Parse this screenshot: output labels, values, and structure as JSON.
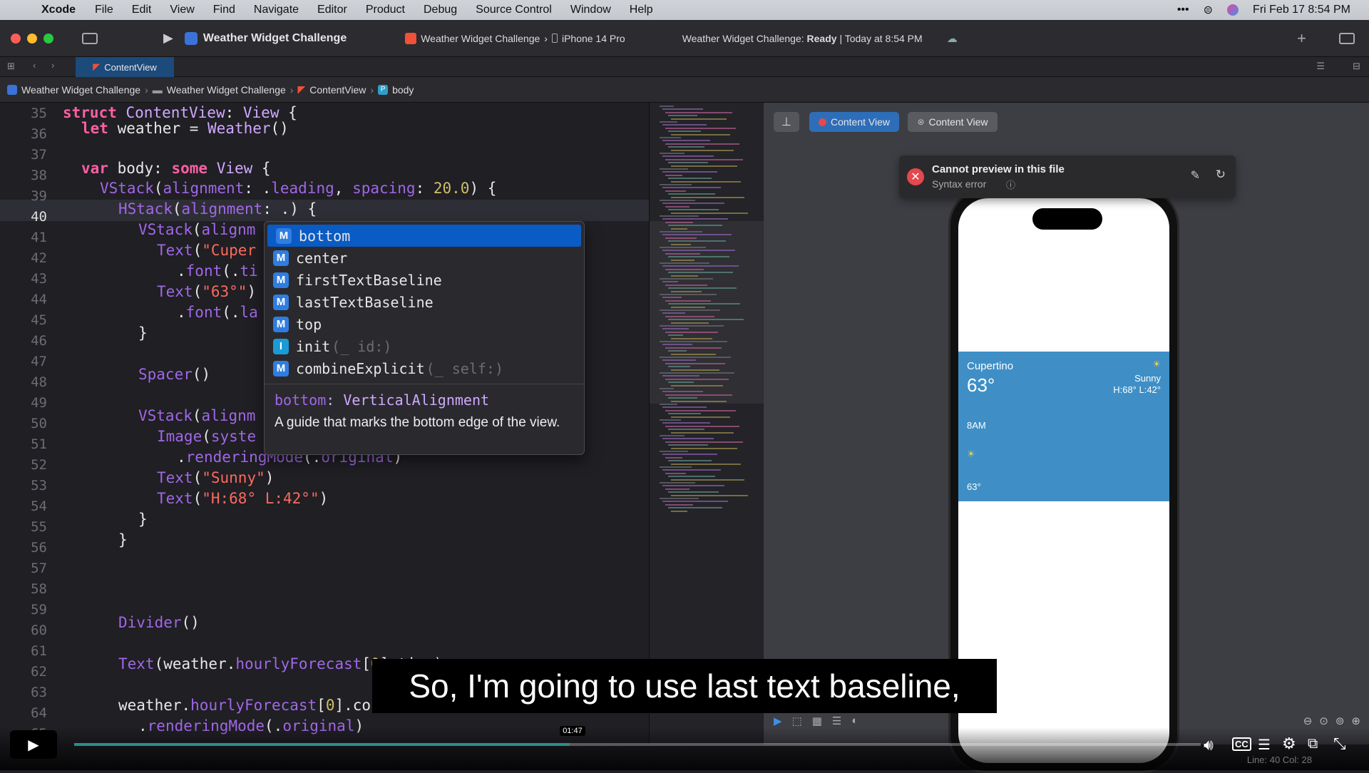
{
  "menubar": {
    "app": "Xcode",
    "items": [
      "File",
      "Edit",
      "View",
      "Find",
      "Navigate",
      "Editor",
      "Product",
      "Debug",
      "Source Control",
      "Window",
      "Help"
    ],
    "datetime": "Fri Feb 17  8:54 PM"
  },
  "toolbar": {
    "project": "Weather Widget Challenge",
    "scheme": "Weather Widget Challenge",
    "device": "iPhone 14 Pro",
    "status_prefix": "Weather Widget Challenge: ",
    "status_state": "Ready",
    "status_time": " | Today at 8:54 PM"
  },
  "tab": {
    "label": "ContentView"
  },
  "breadcrumbs": [
    "Weather Widget Challenge",
    "Weather Widget Challenge",
    "ContentView",
    "body"
  ],
  "editor": {
    "line_numbers": [
      "35",
      "36",
      "37",
      "38",
      "39",
      "40",
      "41",
      "42",
      "43",
      "44",
      "45",
      "46",
      "47",
      "48",
      "49",
      "50",
      "51",
      "52",
      "53",
      "54",
      "55",
      "56",
      "57",
      "58",
      "59",
      "60",
      "61",
      "62",
      "63",
      "64",
      "65"
    ],
    "current_line": "40"
  },
  "autocomplete": {
    "items": [
      {
        "badge": "M",
        "label": "bottom",
        "suffix": ""
      },
      {
        "badge": "M",
        "label": "center",
        "suffix": ""
      },
      {
        "badge": "M",
        "label": "firstTextBaseline",
        "suffix": ""
      },
      {
        "badge": "M",
        "label": "lastTextBaseline",
        "suffix": ""
      },
      {
        "badge": "M",
        "label": "top",
        "suffix": ""
      },
      {
        "badge": "I",
        "label": "init",
        "suffix": "(_ id:)"
      },
      {
        "badge": "M",
        "label": "combineExplicit",
        "suffix": "(_ self:)"
      }
    ],
    "doc_name": "bottom",
    "doc_type": ": VerticalAlignment",
    "doc_desc": "A guide that marks the bottom edge of the view."
  },
  "preview": {
    "chip1": "Content View",
    "chip2": "Content View",
    "error_title": "Cannot preview in this file",
    "error_sub": "Syntax error",
    "widget": {
      "city": "Cupertino",
      "temp": "63°",
      "condition": "Sunny",
      "hilo": "H:68° L:42°",
      "hour": "8AM",
      "hour_temp": "63°"
    },
    "widget_color": "#3f8fc6"
  },
  "subtitle": "So, I'm going to use last text baseline,",
  "player": {
    "time": "01:47",
    "progress": 0.44
  },
  "statusbar": {
    "cursor": "Line: 40  Col: 28"
  }
}
